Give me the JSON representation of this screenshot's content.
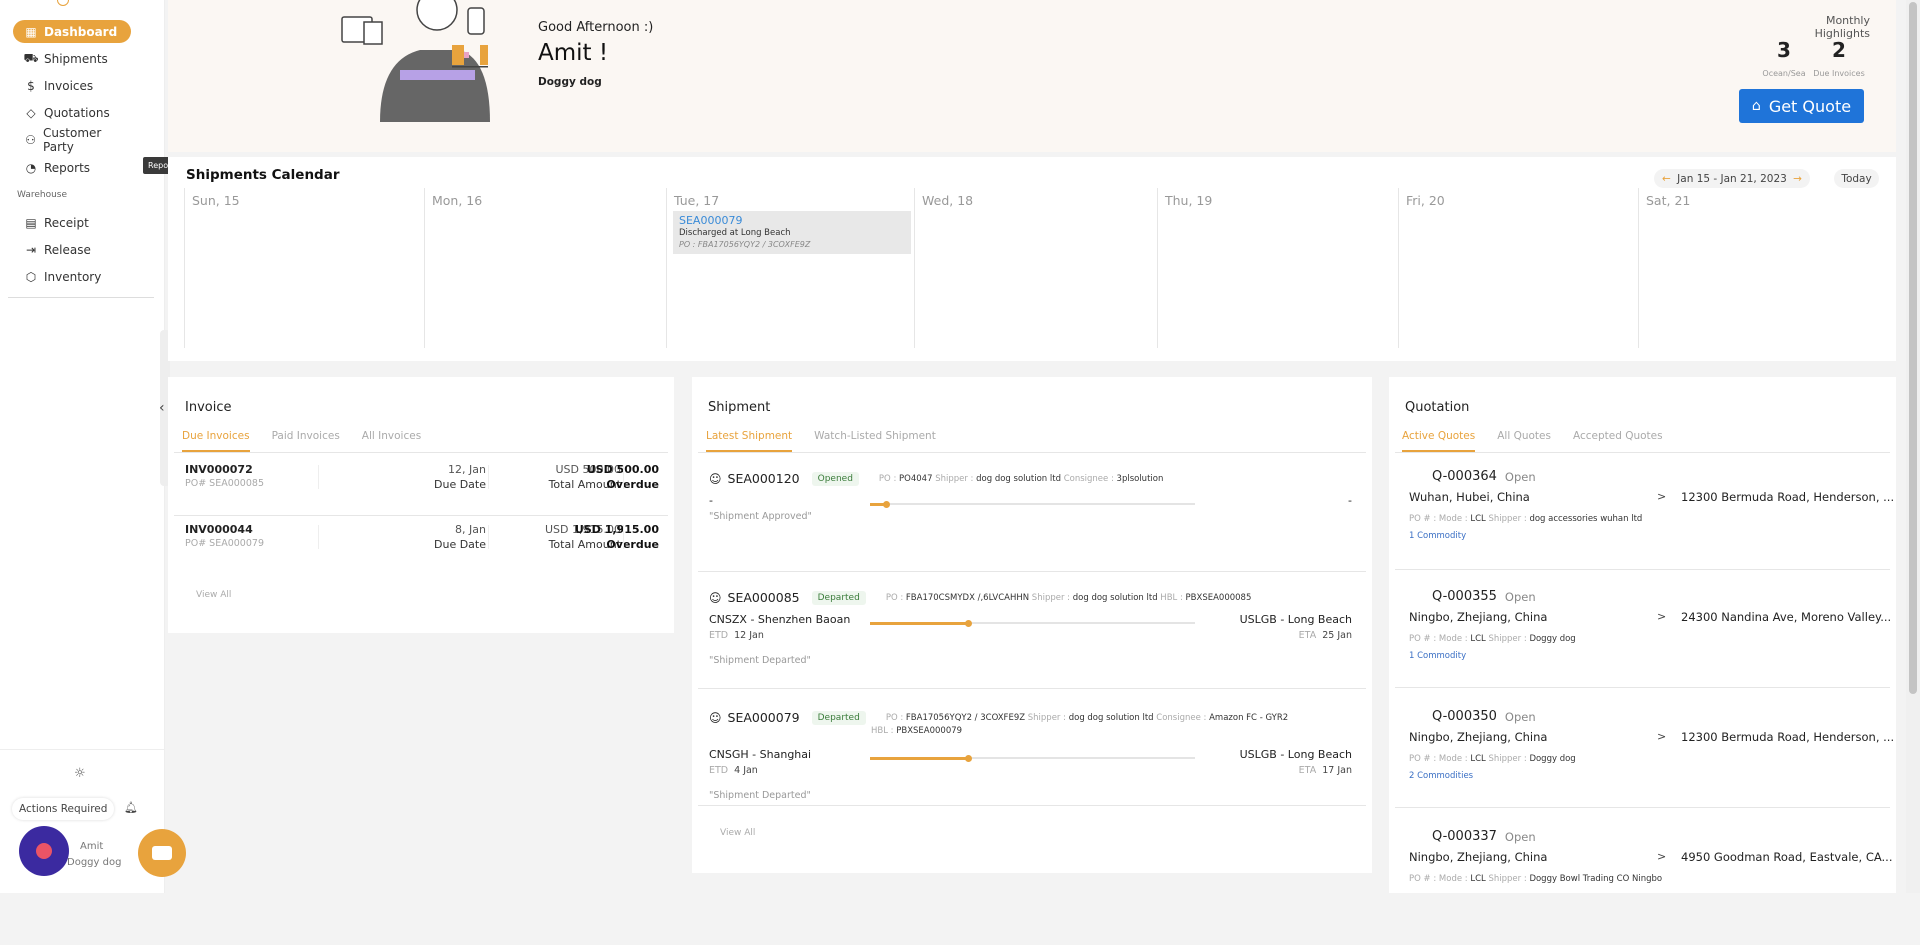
{
  "sidebar": {
    "items": [
      {
        "label": "Dashboard",
        "icon": "grid-icon",
        "active": true
      },
      {
        "label": "Shipments",
        "icon": "truck-icon"
      },
      {
        "label": "Invoices",
        "icon": "dollar-icon"
      },
      {
        "label": "Quotations",
        "icon": "tag-icon"
      },
      {
        "label": "Customer Party",
        "icon": "users-icon"
      },
      {
        "label": "Reports",
        "icon": "pie-chart-icon"
      }
    ],
    "tooltip": "Reports",
    "warehouse_label": "Warehouse",
    "warehouse_items": [
      {
        "label": "Receipt",
        "icon": "file-icon"
      },
      {
        "label": "Release",
        "icon": "logout-icon"
      },
      {
        "label": "Inventory",
        "icon": "box-icon"
      }
    ],
    "actions_required": "Actions Required",
    "user_name": "Amit",
    "user_org": "Doggy dog"
  },
  "hero": {
    "greeting": "Good Afternoon :)",
    "name": "Amit !",
    "org": "Doggy dog",
    "monthly_highlights": "Monthly Highlights",
    "stats": [
      {
        "value": "3",
        "label": "Ocean/Sea"
      },
      {
        "value": "2",
        "label": "Due Invoices"
      }
    ],
    "get_quote": "Get Quote"
  },
  "calendar": {
    "title": "Shipments Calendar",
    "range": "Jan 15 - Jan 21, 2023",
    "today": "Today",
    "days": [
      "Sun, 15",
      "Mon, 16",
      "Tue, 17",
      "Wed, 18",
      "Thu, 19",
      "Fri, 20",
      "Sat, 21"
    ],
    "event": {
      "id": "SEA000079",
      "status": "Discharged at Long Beach",
      "po": "PO : FBA17056YQY2 / 3COXFE9Z"
    }
  },
  "invoice": {
    "title": "Invoice",
    "tabs": [
      "Due Invoices",
      "Paid Invoices",
      "All Invoices"
    ],
    "rows": [
      {
        "id": "INV000072",
        "po": "PO# SEA000085",
        "date": "12, Jan",
        "date_label": "Due Date",
        "amount": "USD 500.00",
        "amount_label": "Total Amount",
        "total": "USD 500.00",
        "status": "Overdue"
      },
      {
        "id": "INV000044",
        "po": "PO# SEA000079",
        "date": "8, Jan",
        "date_label": "Due Date",
        "amount": "USD 1,915.00",
        "amount_label": "Total Amount",
        "total": "USD 1,915.00",
        "status": "Overdue"
      }
    ],
    "view_all": "View All"
  },
  "shipment": {
    "title": "Shipment",
    "tabs": [
      "Latest Shipment",
      "Watch-Listed Shipment"
    ],
    "rows": [
      {
        "id": "SEA000120",
        "status": "Opened",
        "meta": [
          [
            "PO",
            "PO4047"
          ],
          [
            "Shipper",
            "dog dog solution ltd"
          ],
          [
            "Consignee",
            "3plsolution"
          ]
        ],
        "meta2": [],
        "origin": "-",
        "origin_date_label": "",
        "origin_date": "",
        "dest": "-",
        "dest_date_label": "",
        "dest_date": "",
        "note": "\"Shipment Approved\"",
        "progress": 0.05
      },
      {
        "id": "SEA000085",
        "status": "Departed",
        "meta": [
          [
            "PO",
            "FBA170CSMYDX /,6LVCAHHN"
          ],
          [
            "Shipper",
            "dog dog solution ltd"
          ],
          [
            "HBL",
            "PBXSEA000085"
          ]
        ],
        "meta2": [],
        "origin": "CNSZX - Shenzhen Baoan",
        "origin_date_label": "ETD",
        "origin_date": "12 Jan",
        "dest": "USLGB - Long Beach",
        "dest_date_label": "ETA",
        "dest_date": "25 Jan",
        "note": "\"Shipment Departed\"",
        "progress": 0.3
      },
      {
        "id": "SEA000079",
        "status": "Departed",
        "meta": [
          [
            "PO",
            "FBA17056YQY2 / 3COXFE9Z"
          ],
          [
            "Shipper",
            "dog dog solution ltd"
          ],
          [
            "Consignee",
            "Amazon FC - GYR2"
          ]
        ],
        "meta2": [
          [
            "HBL",
            "PBXSEA000079"
          ]
        ],
        "origin": "CNSGH - Shanghai",
        "origin_date_label": "ETD",
        "origin_date": "4 Jan",
        "dest": "USLGB - Long Beach",
        "dest_date_label": "ETA",
        "dest_date": "17 Jan",
        "note": "\"Shipment Departed\"",
        "progress": 0.3
      }
    ],
    "view_all": "View All"
  },
  "quotation": {
    "title": "Quotation",
    "tabs": [
      "Active Quotes",
      "All Quotes",
      "Accepted Quotes"
    ],
    "rows": [
      {
        "id": "Q-000364",
        "status": "Open",
        "from": "Wuhan, Hubei, China",
        "to": "12300 Bermuda Road, Henderson, ...",
        "mode": "LCL",
        "shipper": "dog accessories wuhan ltd",
        "commodity": "1 Commodity"
      },
      {
        "id": "Q-000355",
        "status": "Open",
        "from": "Ningbo, Zhejiang, China",
        "to": "24300 Nandina Ave, Moreno Valley...",
        "mode": "LCL",
        "shipper": "Doggy dog",
        "commodity": "1 Commodity"
      },
      {
        "id": "Q-000350",
        "status": "Open",
        "from": "Ningbo, Zhejiang, China",
        "to": "12300 Bermuda Road, Henderson, ...",
        "mode": "LCL",
        "shipper": "Doggy dog",
        "commodity": "2 Commodities"
      },
      {
        "id": "Q-000337",
        "status": "Open",
        "from": "Ningbo, Zhejiang, China",
        "to": "4950 Goodman Road, Eastvale, CA...",
        "mode": "LCL",
        "shipper": "Doggy Bowl Trading CO Ningbo",
        "commodity": ""
      }
    ],
    "labels": {
      "po": "PO #",
      "mode": "Mode",
      "shipper": "Shipper"
    }
  }
}
